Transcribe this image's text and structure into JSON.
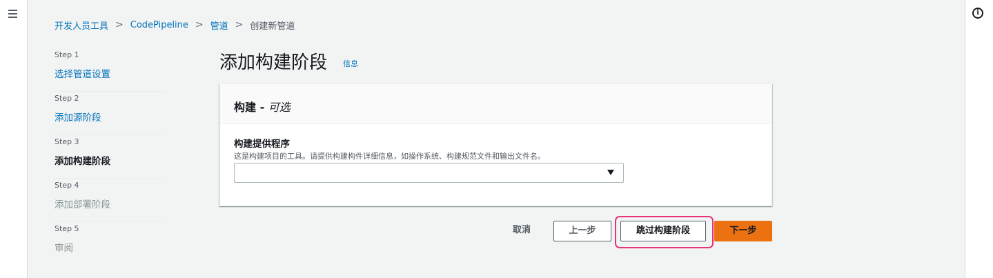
{
  "breadcrumb": {
    "items": [
      "开发人员工具",
      "CodePipeline",
      "管道"
    ],
    "current": "创建新管道"
  },
  "steps": [
    {
      "num": "Step 1",
      "title": "选择管道设置",
      "state": "link"
    },
    {
      "num": "Step 2",
      "title": "添加源阶段",
      "state": "link"
    },
    {
      "num": "Step 3",
      "title": "添加构建阶段",
      "state": "current"
    },
    {
      "num": "Step 4",
      "title": "添加部署阶段",
      "state": "disabled"
    },
    {
      "num": "Step 5",
      "title": "审阅",
      "state": "disabled"
    }
  ],
  "page": {
    "title": "添加构建阶段",
    "info_link": "信息"
  },
  "card": {
    "title": "构建 - ",
    "title_optional": "可选",
    "field_label": "构建提供程序",
    "field_description": "这是构建项目的工具。请提供构建构件详细信息，如操作系统、构建规范文件和输出文件名。",
    "select_value": ""
  },
  "actions": {
    "cancel": "取消",
    "previous": "上一步",
    "skip": "跳过构建阶段",
    "next": "下一步"
  },
  "icons": {
    "menu": "hamburger-menu-icon",
    "info": "info-circle-icon",
    "dropdown": "caret-down-icon",
    "breadcrumb_separator": "chevron-right-icon"
  },
  "colors": {
    "link": "#0073bb",
    "primary_button": "#ec7211",
    "highlight": "#e8337a",
    "background": "#f2f3f3"
  }
}
